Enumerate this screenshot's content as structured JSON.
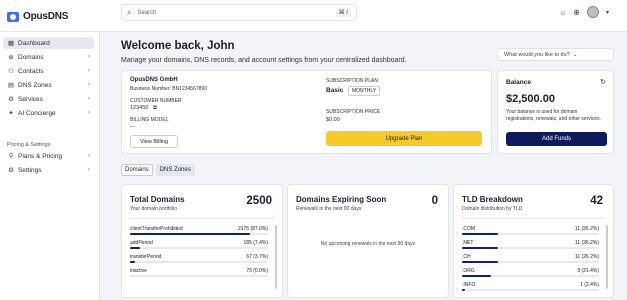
{
  "app": {
    "name": "OpusDNS"
  },
  "search": {
    "placeholder": "Search",
    "shortcut": "⌘ /"
  },
  "icons": {
    "logo": "opusdns-logo-icon",
    "search": "search-icon",
    "theme": "sun-icon",
    "language": "globe-icon",
    "user": "avatar-icon"
  },
  "sidebar": {
    "items": [
      {
        "label": "Dashboard",
        "icon": "grid-icon"
      },
      {
        "label": "Domains",
        "icon": "globe-icon"
      },
      {
        "label": "Contacts",
        "icon": "users-icon"
      },
      {
        "label": "DNS Zones",
        "icon": "server-icon"
      },
      {
        "label": "Services",
        "icon": "services-icon"
      },
      {
        "label": "AI Concierge",
        "icon": "sparkle-icon"
      }
    ],
    "section_label": "Pricing & Settings",
    "bottom_items": [
      {
        "label": "Plans & Pricing",
        "icon": "tag-icon"
      },
      {
        "label": "Settings",
        "icon": "gear-icon"
      }
    ]
  },
  "header": {
    "title": "Welcome back, John",
    "subtitle": "Manage your domains, DNS records, and account settings from your centralized dashboard.",
    "dropdown": "What would you like to do?"
  },
  "account": {
    "company": "OpusDNS GmbH",
    "business_number": "Business Number: BN1234567890",
    "customer_number_label": "CUSTOMER NUMBER",
    "customer_number": "123456",
    "billing_model_label": "BILLING MODEL",
    "billing_model": "---",
    "view_billing": "View Billing",
    "subscription_plan_label": "SUBSCRIPTION PLAN",
    "plan": "Basic",
    "plan_period": "MONTHLY",
    "subscription_price_label": "SUBSCRIPTION PRICE",
    "price": "$0.00",
    "upgrade": "Upgrade Plan"
  },
  "balance": {
    "title": "Balance",
    "amount": "$2,500.00",
    "description": "Your balance is used for domain registrations, renewals, and other services.",
    "add_funds": "Add Funds"
  },
  "tabs": [
    {
      "label": "Domains"
    },
    {
      "label": "DNS Zones"
    }
  ],
  "total_domains": {
    "title": "Total Domains",
    "subtitle": "Your domain portfolio",
    "count": "2500",
    "rows": [
      {
        "label": "clientTransferProhibited",
        "value": "2175 (87.0%)",
        "pct": 87.0
      },
      {
        "label": "addPeriod",
        "value": "185 (7.4%)",
        "pct": 7.4
      },
      {
        "label": "transferPeriod",
        "value": "67 (3.7%)",
        "pct": 3.7
      },
      {
        "label": "inactive",
        "value": "73 (0.0%)",
        "pct": 0.0
      }
    ]
  },
  "expiring": {
    "title": "Domains Expiring Soon",
    "subtitle": "Renewals in the next 90 days",
    "count": "0",
    "empty": "No upcoming renewals in the next 90 days"
  },
  "tld": {
    "title": "TLD Breakdown",
    "subtitle": "Domain distribution by TLD",
    "count": "42",
    "rows": [
      {
        "label": ".COM",
        "value": "11 (26.2%)",
        "pct": 26.2
      },
      {
        "label": ".NET",
        "value": "11 (26.2%)",
        "pct": 26.2
      },
      {
        "label": ".CH",
        "value": "11 (26.2%)",
        "pct": 26.2
      },
      {
        "label": ".ORG",
        "value": "9 (21.4%)",
        "pct": 21.4
      },
      {
        "label": ".INFO",
        "value": "1 (2.4%)",
        "pct": 2.4
      }
    ]
  },
  "colors": {
    "accent": "#15206a",
    "yellow": "#f5cb2c",
    "brand": "#3a6ef0"
  }
}
